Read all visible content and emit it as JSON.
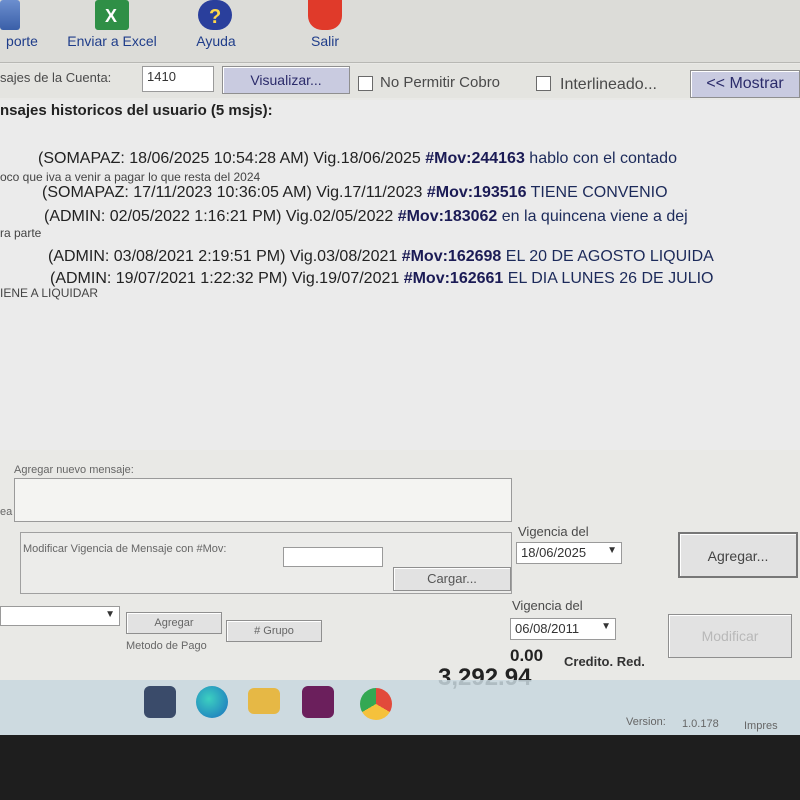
{
  "toolbar": {
    "report_label": "porte",
    "excel_label": "Enviar a Excel",
    "help_label": "Ayuda",
    "exit_label": "Salir"
  },
  "account_row": {
    "messages_label": "sajes de la Cuenta:",
    "account_value": "1410",
    "view_button": "Visualizar...",
    "no_charge_label": "No Permitir Cobro",
    "spacing_label": "Interlineado...",
    "show_button": "<< Mostrar"
  },
  "history": {
    "title": "nsajes historicos del usuario (5 msjs):",
    "messages": [
      {
        "header": "(SOMAPAZ: 18/06/2025 10:54:28 AM) Vig.18/06/2025 ",
        "mov": "#Mov:244163",
        "text": " hablo con el contado"
      },
      {
        "header": "(SOMAPAZ: 17/11/2023 10:36:05 AM) Vig.17/11/2023 ",
        "mov": "#Mov:193516",
        "text": " TIENE CONVENIO"
      },
      {
        "header": "(ADMIN: 02/05/2022 1:16:21 PM) Vig.02/05/2022 ",
        "mov": "#Mov:183062",
        "text": " en la quincena viene a dej"
      },
      {
        "header": "(ADMIN: 03/08/2021 2:19:51 PM) Vig.03/08/2021 ",
        "mov": "#Mov:162698",
        "text": " EL 20 DE AGOSTO LIQUIDA"
      },
      {
        "header": "(ADMIN: 19/07/2021 1:22:32 PM) Vig.19/07/2021 ",
        "mov": "#Mov:162661",
        "text": " EL DIA LUNES 26 DE JULIO"
      }
    ],
    "notes": [
      "oco que iva a venir a pagar lo que resta del 2024",
      "ra parte",
      "IENE A LIQUIDAR"
    ]
  },
  "new_message": {
    "label": "Agregar nuevo mensaje:",
    "side_label": "ea",
    "validity_label": "Vigencia del",
    "validity_date": "18/06/2025",
    "add_button": "Agregar..."
  },
  "modify": {
    "label": "Modificar Vigencia de Mensaje con #Mov:",
    "load_button": "Cargar...",
    "validity_label": "Vigencia del",
    "validity_date": "06/08/2011",
    "modify_button": "Modificar"
  },
  "payment": {
    "add_label": "Agregar",
    "group_label": "# Grupo",
    "method_label": "Metodo de Pago"
  },
  "totals": {
    "credit_value": "0.00",
    "credit_label": "Credito. Red.",
    "total_value": "3,292.94"
  },
  "footer": {
    "version_label": "Version:",
    "version_value": "1.0.178",
    "extra": "Impres"
  }
}
